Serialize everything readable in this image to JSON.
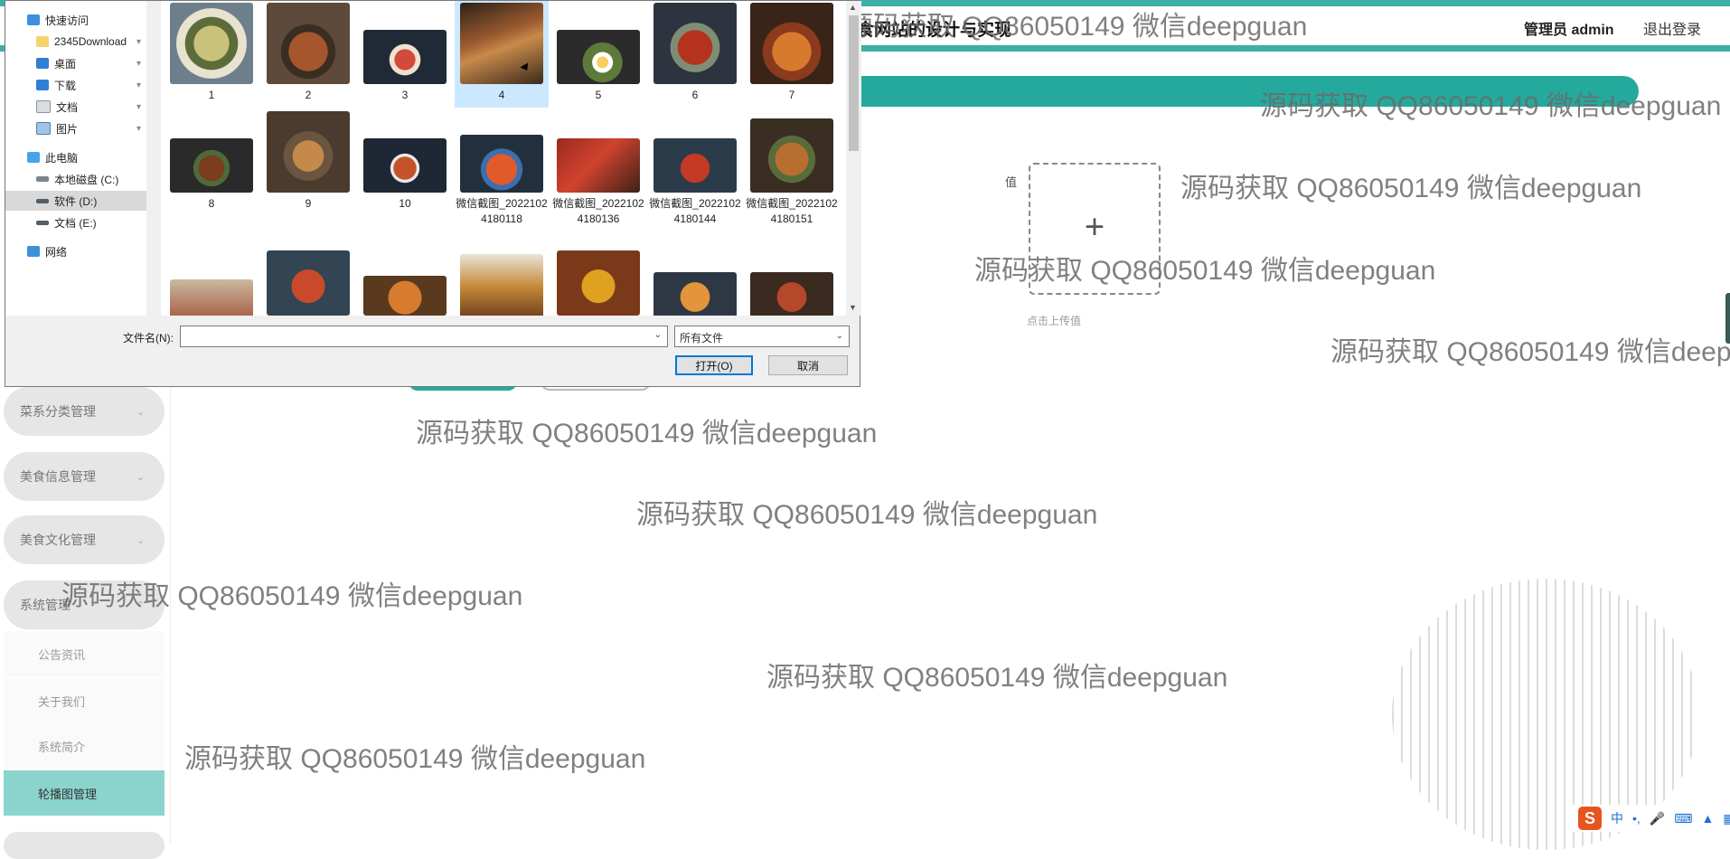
{
  "app": {
    "title_fragment": "食网站的设计与实现",
    "user": "管理员 admin",
    "logout": "退出登录"
  },
  "sidebar": {
    "menus": [
      {
        "label": "菜系分类管理"
      },
      {
        "label": "美食信息管理"
      },
      {
        "label": "美食文化管理"
      },
      {
        "label": "系统管理"
      }
    ],
    "sub_items": [
      {
        "label": "公告资讯"
      },
      {
        "label": "关于我们"
      },
      {
        "label": "系统简介"
      },
      {
        "label": "轮播图管理"
      }
    ]
  },
  "form": {
    "field_label": "值",
    "upload_hint": "点击上传值"
  },
  "watermark_text": "源码获取 QQ86050149 微信deepguan",
  "ime": {
    "lang": "中"
  },
  "dialog": {
    "nav": [
      {
        "label": "快速访问"
      },
      {
        "label": "2345Download"
      },
      {
        "label": "桌面"
      },
      {
        "label": "下载"
      },
      {
        "label": "文档"
      },
      {
        "label": "图片"
      },
      {
        "label": "此电脑"
      },
      {
        "label": "本地磁盘 (C:)"
      },
      {
        "label": "软件 (D:)"
      },
      {
        "label": "文档 (E:)"
      },
      {
        "label": "网络"
      }
    ],
    "files": [
      {
        "name": "1"
      },
      {
        "name": "2"
      },
      {
        "name": "3"
      },
      {
        "name": "4"
      },
      {
        "name": "5"
      },
      {
        "name": "6"
      },
      {
        "name": "7"
      },
      {
        "name": "8"
      },
      {
        "name": "9"
      },
      {
        "name": "10"
      },
      {
        "name": "微信截图_20221024180118"
      },
      {
        "name": "微信截图_20221024180136"
      },
      {
        "name": "微信截图_20221024180144"
      },
      {
        "name": "微信截图_20221024180151"
      }
    ],
    "filename_label": "文件名(N):",
    "filename_value": "",
    "filetype": "所有文件",
    "open_button": "打开(O)",
    "cancel_button": "取消"
  },
  "colors": {
    "accent": "#25a99d",
    "active_menu": "#8ad4cd",
    "selection": "#cce8ff"
  }
}
